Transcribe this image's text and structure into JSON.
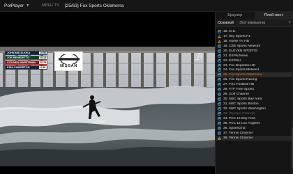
{
  "app": {
    "name": "PotPlayer",
    "format": "MPEG TS",
    "title": "[25/63] Fox Sports Oklahoma"
  },
  "scorebug": [
    {
      "name": "JOHN MATSUOKA",
      "score": "15.50"
    },
    {
      "name": "ZOE BENEDETTO",
      "score": "10.13"
    },
    {
      "name": "COLINDA MARSTRAIN",
      "score": "12.76"
    },
    {
      "name": "KIRA PINKERTON",
      "score": "4.30"
    }
  ],
  "sponsor": "NISSAN",
  "panel": {
    "tabs": [
      {
        "label": "Браузер"
      },
      {
        "label": "Плей-лист"
      }
    ],
    "subtabs": [
      {
        "label": "Основной"
      },
      {
        "label": "Этот компьютер"
      }
    ],
    "add_icon": "+"
  },
  "playlist": [
    {
      "label": "16. KHL",
      "icon": "ie"
    },
    {
      "label": "17. Sky Sports F1",
      "icon": "warn"
    },
    {
      "label": "18. Horse TV HD",
      "icon": "warn"
    },
    {
      "label": "19. CBS Sports Network",
      "icon": "ie"
    },
    {
      "label": "20. ELEVEN SPORTS",
      "icon": "ie"
    },
    {
      "label": "21. ESPN News",
      "icon": "ie"
    },
    {
      "label": "22. ESPNU",
      "icon": "ie"
    },
    {
      "label": "23. Fox Deportes HD",
      "icon": "ie"
    },
    {
      "label": "24. Fox Sports Midwest",
      "icon": "ie"
    },
    {
      "label": "25. Fox Sports Oklahoma",
      "icon": "ie",
      "state": "active"
    },
    {
      "label": "26. Fox Sports Racing",
      "icon": "ie"
    },
    {
      "label": "27. FS1 Football HD",
      "icon": "ie"
    },
    {
      "label": "28. FTF Free Sports",
      "icon": "ie"
    },
    {
      "label": "29. Golf Channel",
      "icon": "ie"
    },
    {
      "label": "30. NBC Sports Bay Area",
      "icon": "ie"
    },
    {
      "label": "31. NBC Sports Boston",
      "icon": "ie"
    },
    {
      "label": "32. NBC Sports Washington",
      "icon": "ie"
    },
    {
      "label": "33. Olympic Channel",
      "icon": "ie",
      "state": "dim"
    },
    {
      "label": "34. PAC 12 Bay Area",
      "icon": "ie"
    },
    {
      "label": "35. PAC 12 Los Angeles",
      "icon": "ie"
    },
    {
      "label": "36. SportsGrid",
      "icon": "ie"
    },
    {
      "label": "37. Tennis Channel",
      "icon": "ie"
    },
    {
      "label": "38. Tennis Channel",
      "icon": "warn",
      "state": "hl"
    }
  ],
  "colors": {
    "active_item": "#e9751f",
    "ie_icon": "#3b8fd8",
    "warn_icon": "#e0a126",
    "dim_text": "#656565"
  }
}
